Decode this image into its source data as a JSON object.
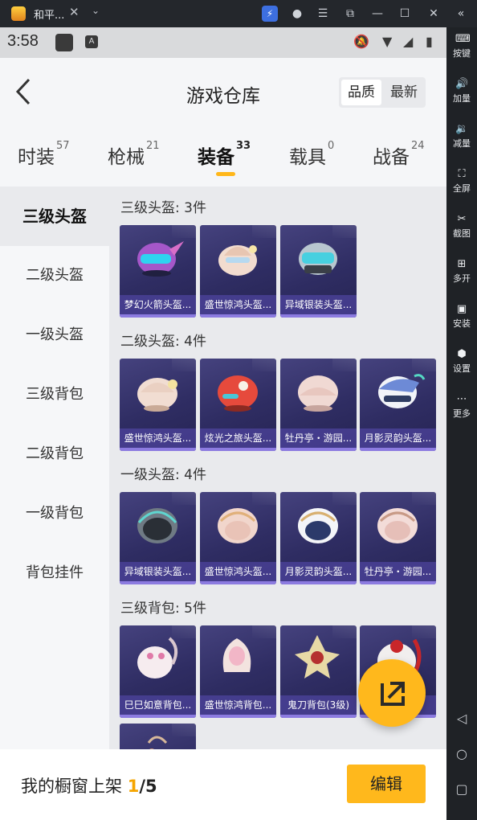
{
  "window": {
    "app_title": "和平...",
    "close_tab": "✕",
    "dropdown": "⌄"
  },
  "statusbar": {
    "time": "3:58",
    "a_badge": "A"
  },
  "sidebar": {
    "items": [
      {
        "label": "按键",
        "icon": "keyboard-icon"
      },
      {
        "label": "加量",
        "icon": "volume-up-icon"
      },
      {
        "label": "减量",
        "icon": "volume-down-icon"
      },
      {
        "label": "全屏",
        "icon": "fullscreen-icon"
      },
      {
        "label": "截图",
        "icon": "scissors-icon"
      },
      {
        "label": "多开",
        "icon": "multi-instance-icon"
      },
      {
        "label": "安装",
        "icon": "apk-install-icon"
      },
      {
        "label": "设置",
        "icon": "gear-icon"
      },
      {
        "label": "更多",
        "icon": "more-icon"
      }
    ]
  },
  "header": {
    "title": "游戏仓库",
    "sort": {
      "quality": "品质",
      "newest": "最新"
    }
  },
  "tabs": [
    {
      "label": "时装",
      "count": "57"
    },
    {
      "label": "枪械",
      "count": "21"
    },
    {
      "label": "装备",
      "count": "33"
    },
    {
      "label": "载具",
      "count": "0"
    },
    {
      "label": "战备",
      "count": "24"
    }
  ],
  "leftnav": [
    "三级头盔",
    "二级头盔",
    "一级头盔",
    "三级背包",
    "二级背包",
    "一级背包",
    "背包挂件"
  ],
  "sections": [
    {
      "title": "三级头盔: 3件",
      "items": [
        "梦幻火箭头盔...",
        "盛世惊鸿头盔...",
        "异域银装头盔..."
      ]
    },
    {
      "title": "二级头盔: 4件",
      "items": [
        "盛世惊鸿头盔...",
        "炫光之旅头盔...",
        "牡丹亭・游园...",
        "月影灵韵头盔..."
      ]
    },
    {
      "title": "一级头盔: 4件",
      "items": [
        "异域银装头盔...",
        "盛世惊鸿头盔...",
        "月影灵韵头盔...",
        "牡丹亭・游园..."
      ]
    },
    {
      "title": "三级背包: 5件",
      "items": [
        "巳巳如意背包...",
        "盛世惊鸿背包...",
        "鬼刀背包(3级)",
        "...包..."
      ]
    }
  ],
  "bottom": {
    "showcase_label": "我的橱窗上架 ",
    "showcase_current": "1",
    "showcase_total": "/5",
    "edit_label": "编辑"
  },
  "colors": {
    "accent": "#ffb81c",
    "card_bg": "#2f2d63",
    "card_label": "#5a4cb4"
  }
}
